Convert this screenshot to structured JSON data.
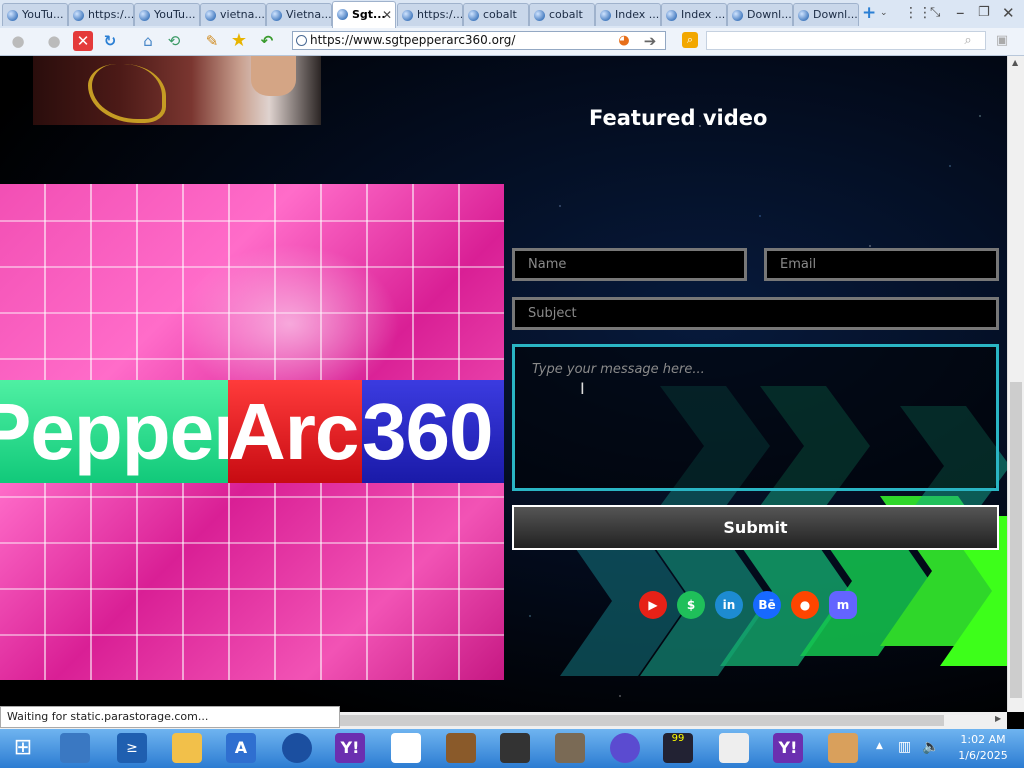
{
  "tabs": [
    {
      "label": "YouTu..."
    },
    {
      "label": "https:/..."
    },
    {
      "label": "YouTu..."
    },
    {
      "label": "vietna..."
    },
    {
      "label": "Vietna..."
    },
    {
      "label": "Sgt..."
    },
    {
      "label": "https:/..."
    },
    {
      "label": "cobalt"
    },
    {
      "label": "cobalt"
    },
    {
      "label": "Index ..."
    },
    {
      "label": "Index ..."
    },
    {
      "label": "Downl..."
    },
    {
      "label": "Downl..."
    }
  ],
  "address": {
    "url": "https://www.sgtpepperarc360.org/"
  },
  "page": {
    "featured_title": "Featured video",
    "logo_text": {
      "part1": "Pepper",
      "part2": "Arc",
      "part3": "360"
    },
    "form": {
      "name_placeholder": "Name",
      "email_placeholder": "Email",
      "subject_placeholder": "Subject",
      "message_placeholder": "Type your message here...",
      "submit_label": "Submit"
    },
    "social": [
      {
        "icon": "youtube-icon",
        "glyph": "▶",
        "color": "#e62117"
      },
      {
        "icon": "dollar-icon",
        "glyph": "$",
        "color": "#1fbf5a"
      },
      {
        "icon": "linkedin-icon",
        "glyph": "in",
        "color": "#1d8bd1"
      },
      {
        "icon": "behance-icon",
        "glyph": "Bē",
        "color": "#1769ff"
      },
      {
        "icon": "reddit-icon",
        "glyph": "●",
        "color": "#ff4500"
      },
      {
        "icon": "mastodon-icon",
        "glyph": "m",
        "color": "#6364ff"
      }
    ]
  },
  "status": {
    "text": "Waiting for static.parastorage.com..."
  },
  "taskbar": {
    "time": "1:02 AM",
    "date": "1/6/2025"
  }
}
